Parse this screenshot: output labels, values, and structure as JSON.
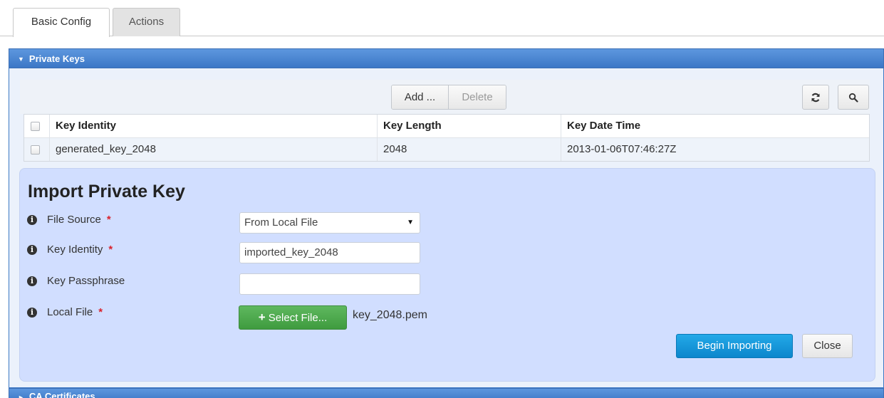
{
  "tabs": [
    {
      "label": "Basic Config",
      "active": true
    },
    {
      "label": "Actions",
      "active": false
    }
  ],
  "panel": {
    "title": "Private Keys",
    "caret": "▼"
  },
  "toolbar": {
    "add_label": "Add ...",
    "delete_label": "Delete",
    "refresh_icon": "refresh-icon",
    "search_icon": "search-icon"
  },
  "table": {
    "headers": [
      "Key Identity",
      "Key Length",
      "Key Date Time"
    ],
    "rows": [
      [
        "generated_key_2048",
        "2048",
        "2013-01-06T07:46:27Z"
      ]
    ]
  },
  "import_form": {
    "title": "Import Private Key",
    "fields": {
      "file_source": {
        "label": "File Source",
        "required": "*",
        "value": "From Local File"
      },
      "key_identity": {
        "label": "Key Identity",
        "required": "*",
        "value": "imported_key_2048"
      },
      "key_passphrase": {
        "label": "Key Passphrase",
        "value": ""
      },
      "local_file": {
        "label": "Local File",
        "required": "*",
        "button": "Select File...",
        "filename": "key_2048.pem"
      }
    },
    "begin_label": "Begin Importing",
    "close_label": "Close"
  },
  "next_panel": {
    "title": "CA Certificates",
    "caret": "►"
  },
  "colors": {
    "panel_header": "#3c77c6",
    "form_bg": "#d1deff",
    "primary": "#0c86cc",
    "success": "#3f9b3f",
    "required": "#d9232e"
  }
}
